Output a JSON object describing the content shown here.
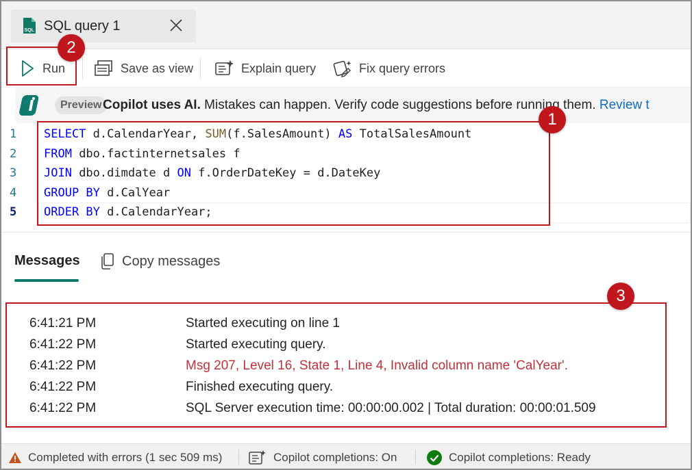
{
  "tab": {
    "title": "SQL query 1",
    "icon": "sql-file-icon"
  },
  "toolbar": {
    "run_label": "Run",
    "save_as_view_label": "Save as view",
    "explain_query_label": "Explain query",
    "fix_query_errors_label": "Fix query errors"
  },
  "banner": {
    "badge": "Preview",
    "bold": "Copilot uses AI.",
    "text": " Mistakes can happen. Verify code suggestions before running them. ",
    "link": "Review t"
  },
  "editor": {
    "line_numbers": [
      "1",
      "2",
      "3",
      "4",
      "5"
    ],
    "lines": [
      [
        {
          "t": "kw",
          "v": "SELECT"
        },
        {
          "t": "p",
          "v": " d.CalendarYear, "
        },
        {
          "t": "fn",
          "v": "SUM"
        },
        {
          "t": "p",
          "v": "(f.SalesAmount) "
        },
        {
          "t": "kw",
          "v": "AS"
        },
        {
          "t": "p",
          "v": " TotalSalesAmount"
        }
      ],
      [
        {
          "t": "kw",
          "v": "FROM"
        },
        {
          "t": "p",
          "v": " dbo.factinternetsales f"
        }
      ],
      [
        {
          "t": "kw",
          "v": "JOIN"
        },
        {
          "t": "p",
          "v": " dbo.dimdate d "
        },
        {
          "t": "kw",
          "v": "ON"
        },
        {
          "t": "p",
          "v": " f.OrderDateKey = d.DateKey"
        }
      ],
      [
        {
          "t": "kw",
          "v": "GROUP BY"
        },
        {
          "t": "p",
          "v": " d.CalYear"
        }
      ],
      [
        {
          "t": "kw",
          "v": "ORDER BY"
        },
        {
          "t": "p",
          "v": " d.CalendarYear;"
        }
      ]
    ]
  },
  "results": {
    "messages_tab": "Messages",
    "copy_messages_label": "Copy messages"
  },
  "messages": [
    {
      "time": "6:41:21 PM",
      "text": "Started executing on line 1",
      "error": false
    },
    {
      "time": "6:41:22 PM",
      "text": "Started executing query.",
      "error": false
    },
    {
      "time": "6:41:22 PM",
      "text": "Msg 207, Level 16, State 1, Line 4, Invalid column name 'CalYear'.",
      "error": true
    },
    {
      "time": "6:41:22 PM",
      "text": "Finished executing query.",
      "error": false
    },
    {
      "time": "6:41:22 PM",
      "text": "SQL Server execution time: 00:00:00.002 | Total duration: 00:00:01.509",
      "error": false
    }
  ],
  "status": {
    "errors": "Completed with errors (1 sec 509 ms)",
    "copilot_completions": "Copilot completions: On",
    "copilot_ready": "Copilot completions: Ready"
  },
  "callouts": {
    "one": "1",
    "two": "2",
    "three": "3"
  },
  "colors": {
    "accent": "#0f7b6c",
    "error": "#c0323a",
    "callout": "#c0171e",
    "keyword": "#0000ff",
    "link": "#0f6cbd"
  }
}
